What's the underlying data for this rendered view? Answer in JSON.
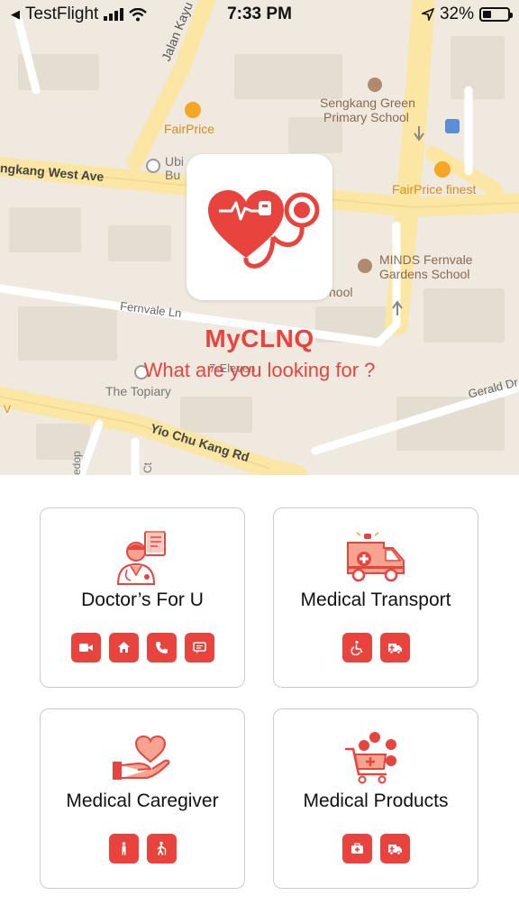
{
  "status_bar": {
    "back_app": "TestFlight",
    "time": "7:33 PM",
    "battery_pct": "32%"
  },
  "map": {
    "labels": {
      "jalan_kayu": "Jalan Kayu",
      "fairprice": "FairPrice",
      "ubin": "Ubi",
      "ubin2": "Bu",
      "sengkang_green": "Sengkang Green",
      "primary_school": "Primary School",
      "west_ave": "ngkang West Ave",
      "fairprice_finest": "FairPrice finest",
      "minds": "MINDS Fernvale",
      "minds2": "Gardens School",
      "chool": "hool",
      "fernvale_ln": "Fernvale Ln",
      "seven_eleven": "7-Eleven",
      "topiary": "The Topiary",
      "gerald": "Gerald Dr",
      "yio_chu_kang": "Yio Chu Kang Rd",
      "edop": "edop",
      "ct": "Ct",
      "v": "V"
    }
  },
  "brand": {
    "name": "MyCLNQ",
    "tagline": "What are you looking for ?"
  },
  "services": [
    {
      "title": "Doctor’s For U",
      "icon": "doctor-icon",
      "actions": [
        "video-icon",
        "home-icon",
        "phone-icon",
        "chat-icon"
      ]
    },
    {
      "title": "Medical Transport",
      "icon": "ambulance-icon",
      "actions": [
        "wheelchair-icon",
        "ambulance-icon"
      ]
    },
    {
      "title": "Medical Caregiver",
      "icon": "heart-hand-icon",
      "actions": [
        "elderly-icon",
        "walking-assist-icon"
      ]
    },
    {
      "title": "Medical Products",
      "icon": "shopping-cart-icon",
      "actions": [
        "first-aid-kit-icon",
        "ambulance-icon"
      ]
    }
  ],
  "colors": {
    "accent": "#e8443d",
    "map_bg": "#efe9df",
    "road_yellow": "#fbe7a3"
  }
}
